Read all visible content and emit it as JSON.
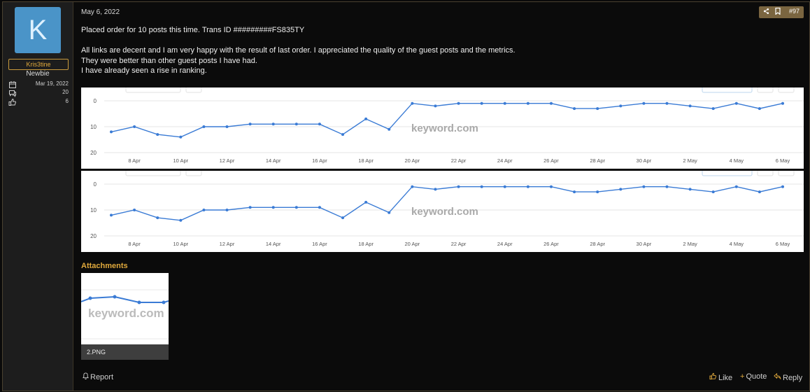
{
  "user": {
    "avatar_letter": "K",
    "name": "Kris3tine",
    "title": "Newbie",
    "stats": [
      {
        "icon": "calendar-icon",
        "value": "Mar 19, 2022"
      },
      {
        "icon": "messages-icon",
        "value": "20"
      },
      {
        "icon": "thumbs-up-icon",
        "value": "6"
      }
    ]
  },
  "post": {
    "date": "May 6, 2022",
    "number": "#97",
    "paragraphs": [
      "Placed order for 10 posts this time. Trans ID #########FS835TY",
      "",
      "All links are decent and I am very happy with the result of last order. I appreciated the quality of the guest posts and the metrics.",
      "They were better than other guest posts I have had.",
      "I have already seen a rise in ranking."
    ]
  },
  "chart_data": [
    {
      "type": "line",
      "watermark": "keyword.com",
      "x": [
        "7 Apr",
        "8 Apr",
        "9 Apr",
        "10 Apr",
        "11 Apr",
        "12 Apr",
        "13 Apr",
        "14 Apr",
        "15 Apr",
        "16 Apr",
        "17 Apr",
        "18 Apr",
        "19 Apr",
        "20 Apr",
        "21 Apr",
        "22 Apr",
        "23 Apr",
        "24 Apr",
        "25 Apr",
        "26 Apr",
        "27 Apr",
        "28 Apr",
        "29 Apr",
        "30 Apr",
        "1 May",
        "2 May",
        "3 May",
        "4 May",
        "5 May",
        "6 May"
      ],
      "tick_labels": [
        "8 Apr",
        "10 Apr",
        "12 Apr",
        "14 Apr",
        "16 Apr",
        "18 Apr",
        "20 Apr",
        "22 Apr",
        "24 Apr",
        "26 Apr",
        "28 Apr",
        "30 Apr",
        "2 May",
        "4 May",
        "6 May"
      ],
      "values": [
        12,
        10,
        13,
        14,
        10,
        10,
        9,
        9,
        9,
        9,
        13,
        7,
        11,
        1,
        2,
        1,
        1,
        1,
        1,
        1,
        3,
        3,
        2,
        1,
        1,
        2,
        3,
        1,
        3,
        1
      ],
      "y_ticks": [
        "0",
        "10",
        "20"
      ],
      "ylim": [
        0,
        20
      ],
      "y_inverted": true,
      "color": "#3a7bd5"
    },
    {
      "type": "line",
      "watermark": "keyword.com",
      "x": [
        "7 Apr",
        "8 Apr",
        "9 Apr",
        "10 Apr",
        "11 Apr",
        "12 Apr",
        "13 Apr",
        "14 Apr",
        "15 Apr",
        "16 Apr",
        "17 Apr",
        "18 Apr",
        "19 Apr",
        "20 Apr",
        "21 Apr",
        "22 Apr",
        "23 Apr",
        "24 Apr",
        "25 Apr",
        "26 Apr",
        "27 Apr",
        "28 Apr",
        "29 Apr",
        "30 Apr",
        "1 May",
        "2 May",
        "3 May",
        "4 May",
        "5 May",
        "6 May"
      ],
      "tick_labels": [
        "8 Apr",
        "10 Apr",
        "12 Apr",
        "14 Apr",
        "16 Apr",
        "18 Apr",
        "20 Apr",
        "22 Apr",
        "24 Apr",
        "26 Apr",
        "28 Apr",
        "30 Apr",
        "2 May",
        "4 May",
        "6 May"
      ],
      "values": [
        12,
        10,
        13,
        14,
        10,
        10,
        9,
        9,
        9,
        9,
        13,
        7,
        11,
        1,
        2,
        1,
        1,
        1,
        1,
        1,
        3,
        3,
        2,
        1,
        1,
        2,
        3,
        1,
        3,
        1
      ],
      "y_ticks": [
        "0",
        "10",
        "20"
      ],
      "ylim": [
        0,
        20
      ],
      "y_inverted": true,
      "color": "#3a7bd5"
    }
  ],
  "attachments": {
    "title": "Attachments",
    "items": [
      {
        "filename": "2.PNG",
        "watermark": "keyword.com"
      }
    ]
  },
  "footer": {
    "report": "Report",
    "like": "Like",
    "quote": "Quote",
    "reply": "Reply"
  },
  "colors": {
    "accent": "#e0a93c",
    "avatar": "#4a94c8",
    "line": "#3a7bd5"
  }
}
